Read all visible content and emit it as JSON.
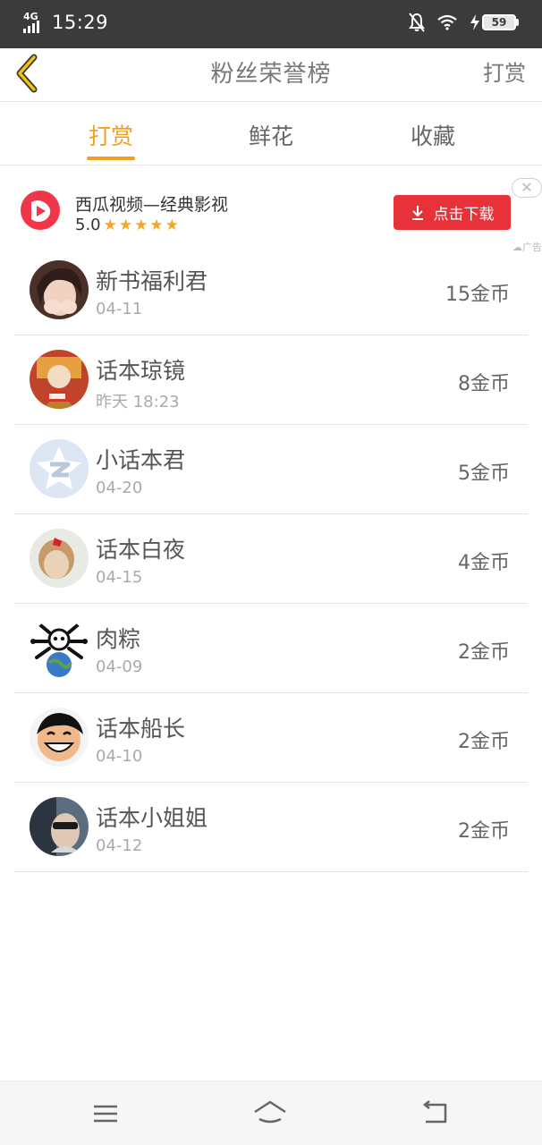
{
  "status_bar": {
    "network": "4G",
    "time": "15:29",
    "battery": "59"
  },
  "header": {
    "title": "粉丝荣誉榜",
    "right_action": "打赏"
  },
  "tabs": [
    {
      "label": "打赏",
      "active": true
    },
    {
      "label": "鲜花",
      "active": false
    },
    {
      "label": "收藏",
      "active": false
    }
  ],
  "ad": {
    "app_name": "西瓜视频—经典影视",
    "rating": "5.0",
    "stars": 5,
    "button_label": "点击下载",
    "close_symbol": "✕",
    "tag": "广告",
    "icon": "xigua-video-logo"
  },
  "rankings": [
    {
      "name": "新书福利君",
      "date": "04-11",
      "amount": "15金币"
    },
    {
      "name": "话本琼镜",
      "date": "昨天 18:23",
      "amount": "8金币"
    },
    {
      "name": "小话本君",
      "date": "04-20",
      "amount": "5金币"
    },
    {
      "name": "话本白夜",
      "date": "04-15",
      "amount": "4金币"
    },
    {
      "name": "肉粽",
      "date": "04-09",
      "amount": "2金币"
    },
    {
      "name": "话本船长",
      "date": "04-10",
      "amount": "2金币"
    },
    {
      "name": "话本小姐姐",
      "date": "04-12",
      "amount": "2金币"
    }
  ],
  "colors": {
    "accent": "#f0a020",
    "ad_button": "#e8323a",
    "status_bar": "#3b3b3b"
  },
  "navbar": {
    "icons": [
      "menu-icon",
      "home-icon",
      "back-nav-icon"
    ]
  }
}
